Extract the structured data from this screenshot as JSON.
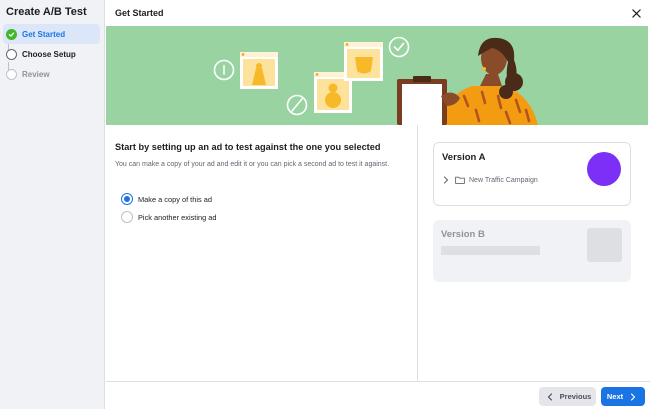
{
  "sidebar": {
    "title": "Create A/B Test",
    "steps": [
      {
        "label": "Get Started",
        "state": "active"
      },
      {
        "label": "Choose Setup",
        "state": "pending"
      },
      {
        "label": "Review",
        "state": "disabled"
      }
    ]
  },
  "header": {
    "title": "Get Started",
    "close_icon": "close-icon"
  },
  "content": {
    "heading": "Start by setting up an ad to test against the one you selected",
    "description": "You can make a copy of your ad and edit it or you can pick a second ad to test it against.",
    "options": [
      {
        "label": "Make a copy of this ad",
        "selected": true
      },
      {
        "label": "Pick another existing ad",
        "selected": false
      }
    ]
  },
  "version_a": {
    "title": "Version A",
    "campaign": "New Traffic Campaign",
    "avatar_color": "#7b2ff7"
  },
  "version_b": {
    "title": "Version B"
  },
  "footer": {
    "previous_label": "Previous",
    "next_label": "Next"
  },
  "colors": {
    "accent": "#1b74e4",
    "banner": "#99d3a1",
    "success": "#42b72a"
  }
}
